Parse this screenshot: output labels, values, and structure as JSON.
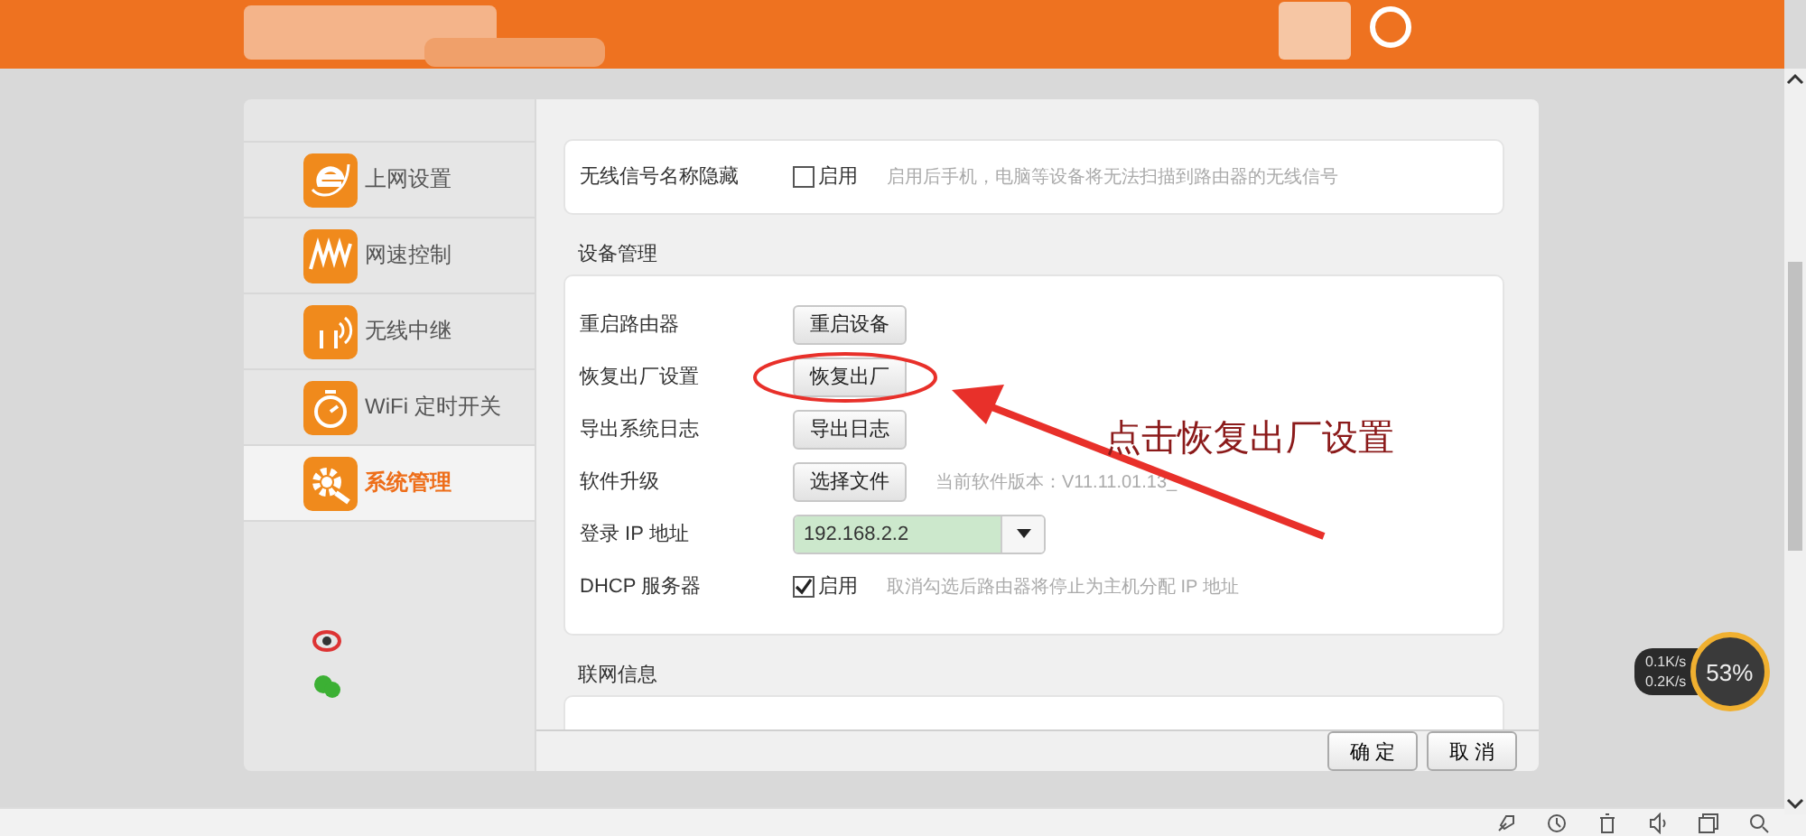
{
  "sidebar": {
    "items": [
      {
        "label": "上网设置",
        "selected": false
      },
      {
        "label": "网速控制",
        "selected": false
      },
      {
        "label": "无线中继",
        "selected": false
      },
      {
        "label": "WiFi 定时开关",
        "selected": false
      },
      {
        "label": "系统管理",
        "selected": true
      }
    ]
  },
  "top_section": {
    "rows": [
      {
        "kind": "checkbox",
        "label": "无线信号名称隐藏",
        "option": "启用",
        "checked": false,
        "hint": "启用后手机，电脑等设备将无法扫描到路由器的无线信号"
      }
    ]
  },
  "device_section": {
    "title": "设备管理",
    "rows": [
      {
        "kind": "button",
        "label": "重启路由器",
        "button": "重启设备"
      },
      {
        "kind": "button",
        "label": "恢复出厂设置",
        "button": "恢复出厂"
      },
      {
        "kind": "button",
        "label": "导出系统日志",
        "button": "导出日志"
      },
      {
        "kind": "button",
        "label": "软件升级",
        "button": "选择文件",
        "hint": "当前软件版本：V11.11.01.13_"
      },
      {
        "kind": "select",
        "label": "登录 IP 地址",
        "value": "192.168.2.2"
      },
      {
        "kind": "checkbox",
        "label": "DHCP 服务器",
        "option": "启用",
        "checked": true,
        "hint": "取消勾选后路由器将停止为主机分配 IP 地址"
      }
    ]
  },
  "network_section": {
    "title": "联网信息"
  },
  "footer": {
    "buttons": [
      "确 定",
      "取 消"
    ]
  },
  "annotation": {
    "text": "点击恢复出厂设置"
  },
  "speed_widget": {
    "upload": "0.1K/s",
    "download": "0.2K/s",
    "percent": "53%"
  }
}
